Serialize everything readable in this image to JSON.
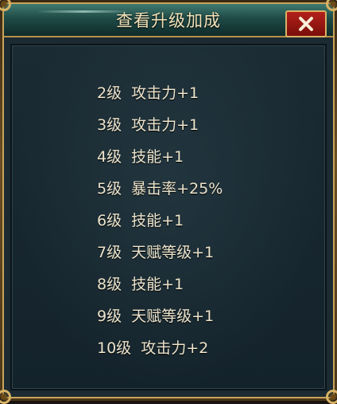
{
  "dialog": {
    "title": "查看升级加成",
    "close_icon": "close-x-icon"
  },
  "colors": {
    "frame_gold": "#c9a45a",
    "title_teal": "#1f4a46",
    "close_red": "#b3201a",
    "panel_bg": "#1c2a31",
    "text": "#ece4cc"
  },
  "bonuses": [
    {
      "level": "2级",
      "bonus": "攻击力+1"
    },
    {
      "level": "3级",
      "bonus": "攻击力+1"
    },
    {
      "level": "4级",
      "bonus": "技能+1"
    },
    {
      "level": "5级",
      "bonus": "暴击率+25%"
    },
    {
      "level": "6级",
      "bonus": "技能+1"
    },
    {
      "level": "7级",
      "bonus": "天赋等级+1"
    },
    {
      "level": "8级",
      "bonus": "技能+1"
    },
    {
      "level": "9级",
      "bonus": "天赋等级+1"
    },
    {
      "level": "10级",
      "bonus": "攻击力+2"
    }
  ]
}
